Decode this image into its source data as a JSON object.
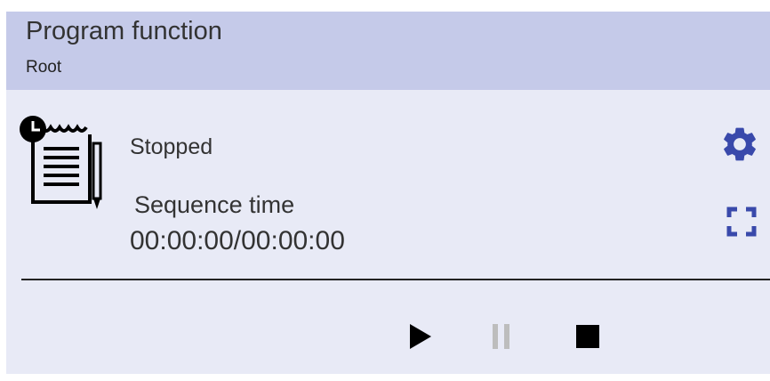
{
  "header": {
    "title": "Program function",
    "subtitle": "Root"
  },
  "program": {
    "status": "Stopped",
    "sequence_label": "Sequence time",
    "sequence_value": "00:00:00/00:00:00"
  },
  "icons": {
    "program": "program-clipboard-clock-icon",
    "settings": "gear-icon",
    "expand": "fullscreen-expand-icon",
    "play": "play-icon",
    "pause": "pause-icon",
    "stop": "stop-icon"
  },
  "controls": {
    "pause_enabled": false
  },
  "colors": {
    "header_bg": "#c5cae9",
    "card_bg": "#e8eaf6",
    "accent": "#3949ab",
    "disabled": "#bdbdbd"
  }
}
